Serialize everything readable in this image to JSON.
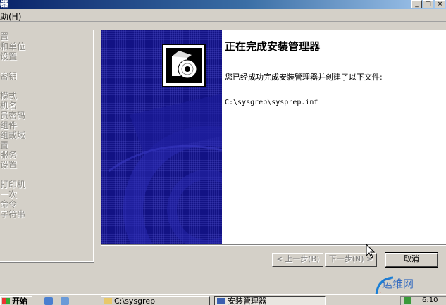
{
  "window": {
    "title": "器"
  },
  "menubar": {
    "help": "助(H)"
  },
  "tree": {
    "items": [
      "置",
      "和单位",
      "设置",
      "",
      "密钥",
      "模式",
      "机名",
      "员密码",
      "组件",
      "组或域",
      "置",
      "服务",
      "设置",
      "",
      "打印机",
      "一次",
      "命令",
      "字符串"
    ]
  },
  "wizard": {
    "title": "正在完成安装管理器",
    "description": "您已经成功完成安装管理器并创建了以下文件:",
    "file_path": "C:\\sysgrep\\sysprep.inf",
    "buttons": {
      "back": "< 上一步(B)",
      "next": "下一步(N) >",
      "cancel": "取消"
    }
  },
  "taskbar": {
    "start": "开始",
    "tasks": [
      "C:\\sysgrep",
      "安装管理器"
    ],
    "clock": "6:10"
  },
  "watermark": {
    "text": "运维网",
    "url": "iyunv.com"
  },
  "colors": {
    "titlebar": "#0a246a",
    "banner": "#0a0a7a",
    "face": "#d4d0c8"
  }
}
